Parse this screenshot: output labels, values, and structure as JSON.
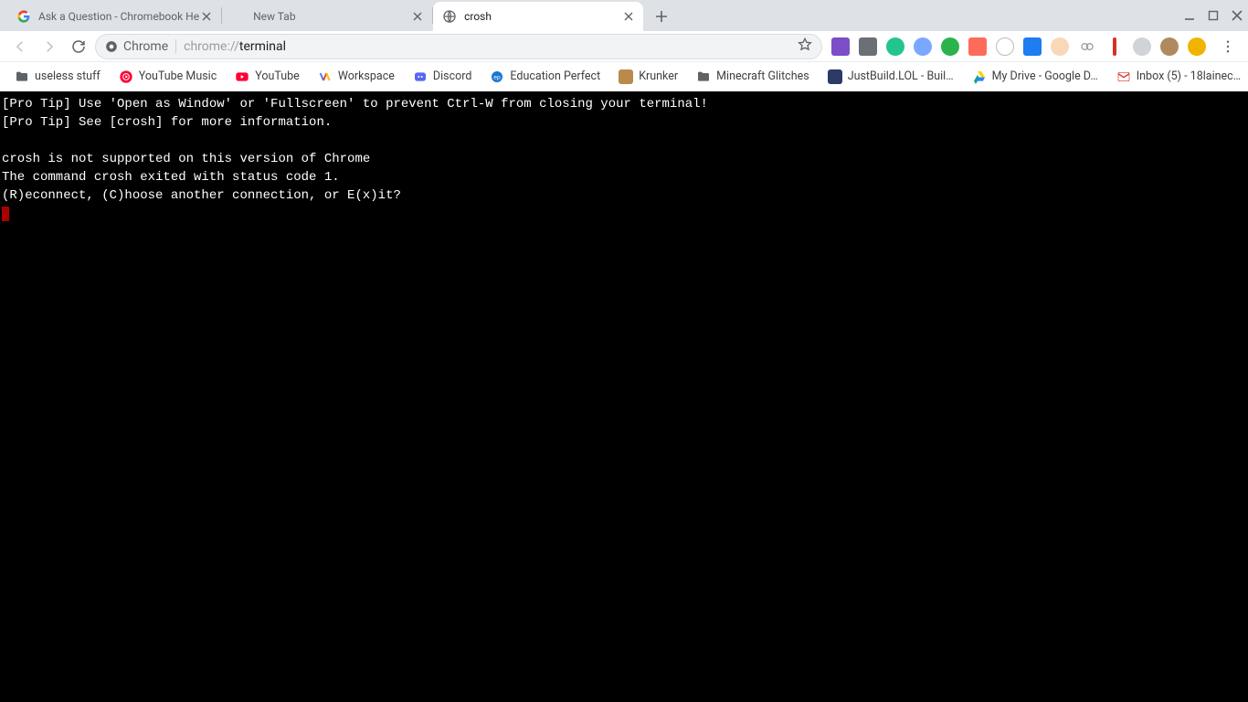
{
  "tabs": [
    {
      "title": "Ask a Question - Chromebook He",
      "favicon": "google",
      "active": false
    },
    {
      "title": "New Tab",
      "favicon": "none",
      "active": false
    },
    {
      "title": "crosh",
      "favicon": "globe",
      "active": true
    }
  ],
  "window_buttons": [
    "minimize",
    "maximize",
    "close"
  ],
  "toolbar": {
    "site_chip": "Chrome",
    "url_prefix": "chrome://",
    "url_emph": "terminal"
  },
  "extensions": [
    {
      "name": "ext-1",
      "color": "#7b4dc7"
    },
    {
      "name": "ext-2",
      "color": "#6b6f76"
    },
    {
      "name": "ext-3",
      "color": "#22c58b"
    },
    {
      "name": "ext-4",
      "color": "#7aa7ff"
    },
    {
      "name": "ext-5",
      "color": "#2bb24c"
    },
    {
      "name": "ext-6",
      "color": "#ff6b5b"
    },
    {
      "name": "ext-7",
      "color": "#9aa0a6"
    },
    {
      "name": "ext-8",
      "color": "#1e7df0"
    },
    {
      "name": "ext-9",
      "color": "#d7a26b"
    },
    {
      "name": "ext-10",
      "color": "#9aa0a6"
    },
    {
      "name": "ext-11",
      "color": "#d93025"
    },
    {
      "name": "ext-12",
      "color": "#9aa0a6"
    },
    {
      "name": "ext-13",
      "color": "#af8a5c"
    },
    {
      "name": "ext-14",
      "color": "#f0b400"
    }
  ],
  "bookmarks": [
    {
      "label": "useless stuff",
      "icon": "folder"
    },
    {
      "label": "YouTube Music",
      "icon": "ytmusic"
    },
    {
      "label": "YouTube",
      "icon": "youtube"
    },
    {
      "label": "Workspace",
      "icon": "workspace"
    },
    {
      "label": "Discord",
      "icon": "discord"
    },
    {
      "label": "Education Perfect",
      "icon": "ep"
    },
    {
      "label": "Krunker",
      "icon": "krunker"
    },
    {
      "label": "Minecraft Glitches",
      "icon": "folder"
    },
    {
      "label": "JustBuild.LOL - Buil…",
      "icon": "justbuild"
    },
    {
      "label": "My Drive - Google D…",
      "icon": "drive"
    },
    {
      "label": "Inbox (5) - 18lainec…",
      "icon": "gmail"
    }
  ],
  "terminal": {
    "lines": [
      "[Pro Tip] Use 'Open as Window' or 'Fullscreen' to prevent Ctrl-W from closing your terminal!",
      "[Pro Tip] See [crosh] for more information.",
      "",
      "crosh is not supported on this version of Chrome",
      "The command crosh exited with status code 1.",
      "(R)econnect, (C)hoose another connection, or E(x)it?"
    ]
  }
}
